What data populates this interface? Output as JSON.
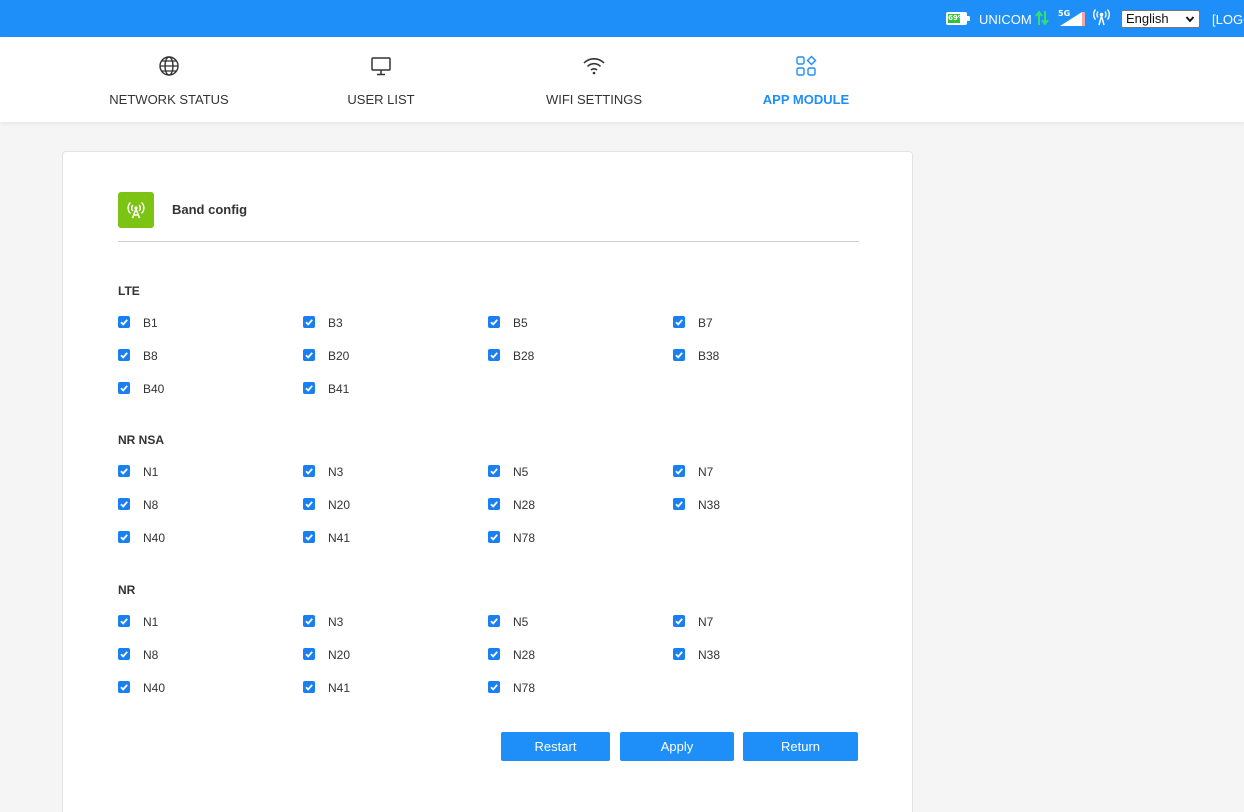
{
  "topbar": {
    "battery_percent": "69%",
    "battery_level": 0.69,
    "carrier": "UNICOM",
    "network_type": "5G",
    "language": "English",
    "logout": "[LOGOUT]",
    "colors": {
      "bar": "#1e8ff8",
      "battery": "#33c23a",
      "data_arrows": "#2fe07a"
    }
  },
  "nav": {
    "items": [
      {
        "label": "NETWORK STATUS",
        "icon": "globe-icon",
        "active": false
      },
      {
        "label": "USER LIST",
        "icon": "monitor-icon",
        "active": false
      },
      {
        "label": "WIFI SETTINGS",
        "icon": "wifi-icon",
        "active": false
      },
      {
        "label": "APP MODULE",
        "icon": "app-grid-icon",
        "active": true
      }
    ]
  },
  "card": {
    "title": "Band config",
    "icon": "signal-tower-icon",
    "icon_color": "#7cc313",
    "sections": [
      {
        "title": "LTE",
        "bands": [
          "B1",
          "B3",
          "B5",
          "B7",
          "B8",
          "B20",
          "B28",
          "B38",
          "B40",
          "B41"
        ]
      },
      {
        "title": "NR NSA",
        "bands": [
          "N1",
          "N3",
          "N5",
          "N7",
          "N8",
          "N20",
          "N28",
          "N38",
          "N40",
          "N41",
          "N78"
        ]
      },
      {
        "title": "NR",
        "bands": [
          "N1",
          "N3",
          "N5",
          "N7",
          "N8",
          "N20",
          "N28",
          "N38",
          "N40",
          "N41",
          "N78"
        ]
      }
    ],
    "checked_color": "#1a7ff1",
    "buttons": {
      "restart": "Restart",
      "apply": "Apply",
      "return": "Return"
    }
  }
}
